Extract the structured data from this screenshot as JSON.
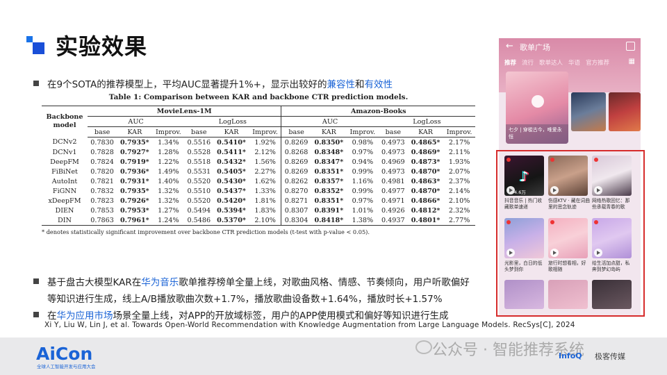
{
  "slide": {
    "title": "实验效果",
    "bullet1": {
      "pre": "在9个SOTA的推荐模型上，平均AUC显著提升1%+，显示出较好的",
      "hl1": "兼容性",
      "mid": "和",
      "hl2": "有效性"
    },
    "bullet2": {
      "pre": "基于盘古大模型KAR在",
      "hl": "华为音乐",
      "post": "歌单推荐榜单全量上线，对歌曲风格、情感、节奏倾向，用户听歌偏好",
      "line2": "等知识进行生成，线上A/B播放歌曲次数+1.7%，播放歌曲设备数+1.64%，播放时长+1.57%"
    },
    "bullet3": {
      "pre": "在",
      "hl": "华为应用市场",
      "post": "场景全量上线，对APP的开放域标签，用户的APP使用模式和偏好等知识进行生成"
    },
    "reference": "Xi Y, Liu W, Lin J, et al. Towards Open-World Recommendation with Knowledge Augmentation from Large Language Models. RecSys[C], 2024"
  },
  "table": {
    "caption": "Table 1: Comparison between KAR and backbone CTR prediction models.",
    "backbone_header": "Backbone model",
    "datasets": [
      "MovieLens-1M",
      "Amazon-Books"
    ],
    "metrics": [
      "AUC",
      "LogLoss"
    ],
    "subcols": [
      "base",
      "KAR",
      "Improv."
    ],
    "rows": [
      {
        "model": "DCNv2",
        "v": [
          "0.7830",
          "0.7935*",
          "1.34%",
          "0.5516",
          "0.5410*",
          "1.92%",
          "0.8269",
          "0.8350*",
          "0.98%",
          "0.4973",
          "0.4865*",
          "2.17%"
        ]
      },
      {
        "model": "DCNv1",
        "v": [
          "0.7828",
          "0.7927*",
          "1.28%",
          "0.5528",
          "0.5411*",
          "2.12%",
          "0.8268",
          "0.8348*",
          "0.97%",
          "0.4973",
          "0.4869*",
          "2.11%"
        ]
      },
      {
        "model": "DeepFM",
        "v": [
          "0.7824",
          "0.7919*",
          "1.22%",
          "0.5518",
          "0.5432*",
          "1.56%",
          "0.8269",
          "0.8347*",
          "0.94%",
          "0.4969",
          "0.4873*",
          "1.93%"
        ]
      },
      {
        "model": "FiBiNet",
        "v": [
          "0.7820",
          "0.7936*",
          "1.49%",
          "0.5531",
          "0.5405*",
          "2.27%",
          "0.8269",
          "0.8351*",
          "0.99%",
          "0.4973",
          "0.4870*",
          "2.07%"
        ]
      },
      {
        "model": "AutoInt",
        "v": [
          "0.7821",
          "0.7931*",
          "1.40%",
          "0.5520",
          "0.5430*",
          "1.62%",
          "0.8262",
          "0.8357*",
          "1.16%",
          "0.4981",
          "0.4863*",
          "2.37%"
        ]
      },
      {
        "model": "FiGNN",
        "v": [
          "0.7832",
          "0.7935*",
          "1.32%",
          "0.5510",
          "0.5437*",
          "1.33%",
          "0.8270",
          "0.8352*",
          "0.99%",
          "0.4977",
          "0.4870*",
          "2.14%"
        ]
      },
      {
        "model": "xDeepFM",
        "v": [
          "0.7823",
          "0.7926*",
          "1.32%",
          "0.5520",
          "0.5420*",
          "1.81%",
          "0.8271",
          "0.8351*",
          "0.97%",
          "0.4971",
          "0.4866*",
          "2.10%"
        ]
      },
      {
        "model": "DIEN",
        "v": [
          "0.7853",
          "0.7953*",
          "1.27%",
          "0.5494",
          "0.5394*",
          "1.83%",
          "0.8307",
          "0.8391*",
          "1.01%",
          "0.4926",
          "0.4812*",
          "2.32%"
        ]
      },
      {
        "model": "DIN",
        "v": [
          "0.7863",
          "0.7961*",
          "1.24%",
          "0.5486",
          "0.5370*",
          "2.10%",
          "0.8304",
          "0.8418*",
          "1.38%",
          "0.4937",
          "0.4801*",
          "2.77%"
        ]
      }
    ],
    "note": "* denotes statistically significant improvement over backbone CTR prediction models (t-test with p-value < 0.05)."
  },
  "phone": {
    "back_icon": "arrow-left-icon",
    "title": "歌单广场",
    "tabs": [
      "推荐",
      "流行",
      "歌单达人",
      "华语",
      "官方推荐"
    ],
    "main_caption": "七夕 | 穿梭古今，唯爱永恒",
    "tiles": [
      {
        "caption": "抖音音乐 | 热门收藏歌单速递",
        "count": "4.6万"
      },
      {
        "caption": "伤感KTV · 藏在词曲里的思念轨迹",
        "count": ""
      },
      {
        "caption": "网络热歌回忆：那些承载青春的歌",
        "count": ""
      },
      {
        "caption": "光影里，白日的低头梦到你",
        "count": ""
      },
      {
        "caption": "旅行时想看相，好歌相随",
        "count": ""
      },
      {
        "caption": "给生活加点甜，私奔到梦幻岛屿",
        "count": ""
      }
    ]
  },
  "footer": {
    "brand": "AiCon",
    "brand_sub": "全球人工智能开发与应用大会",
    "watermark": "公众号 · 智能推荐系统",
    "infoq": "InfoQ",
    "jike": "极客传媒"
  },
  "colors": {
    "accent": "#1a63d6",
    "red_frame": "#d62b2b"
  }
}
